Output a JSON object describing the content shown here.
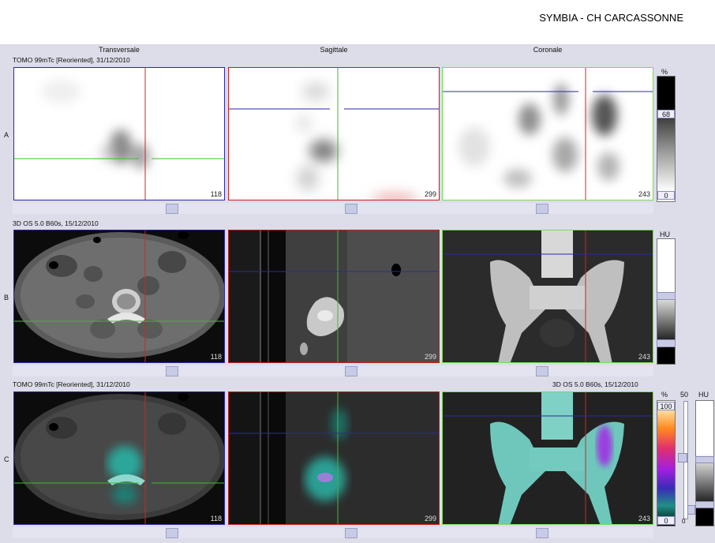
{
  "header": {
    "hospital": "SYMBIA - CH CARCASSONNE"
  },
  "columns": [
    "Transversale",
    "Sagittale",
    "Coronale"
  ],
  "rows": [
    {
      "letter": "A",
      "info": "TOMO 99mTc [Reoriented], 31/12/2010",
      "slices": [
        "118",
        "299",
        "243"
      ]
    },
    {
      "letter": "B",
      "info": "3D  OS  5.0  B60s, 15/12/2010",
      "slices": [
        "118",
        "299",
        "243"
      ]
    },
    {
      "letter": "C",
      "info_left": "TOMO 99mTc [Reoriented], 31/12/2010",
      "info_right": "3D  OS  5.0  B60s, 15/12/2010",
      "slices": [
        "118",
        "299",
        "243"
      ]
    }
  ],
  "scales": {
    "a": {
      "unit": "%",
      "top": "68",
      "bottom": "0"
    },
    "b": {
      "unit": "HU"
    },
    "c": {
      "unit_pct": "%",
      "top": "100",
      "bottom": "0",
      "blend": "50",
      "blend_bottom": "0",
      "unit_hu": "HU"
    }
  },
  "colors": {
    "axial_border": "#2a2aa8",
    "sagittal_border": "#c81e1e",
    "coronal_border": "#7bd95a",
    "background": "#dcdde8"
  }
}
